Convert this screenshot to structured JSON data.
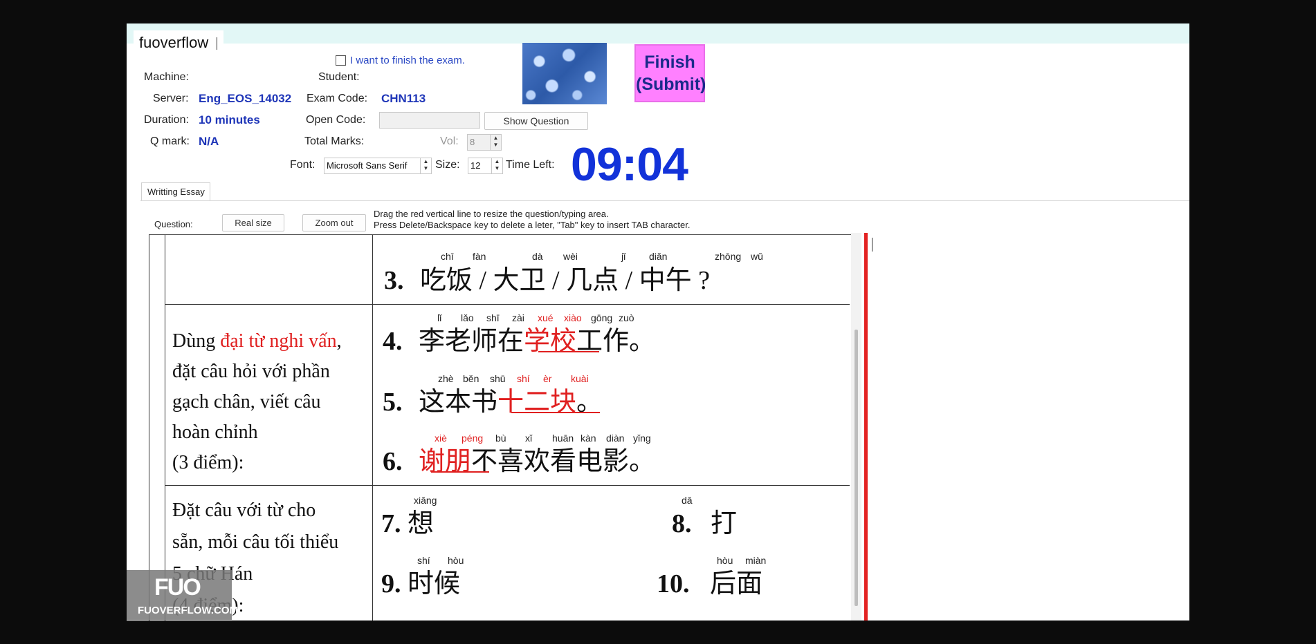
{
  "app": {
    "brand": "fuoverflow",
    "finish_checkbox_label": "I want to finish the exam.",
    "finish_button": [
      "Finish",
      "(Submit)"
    ]
  },
  "info": {
    "machine_label": "Machine:",
    "student_label": "Student:",
    "server_label": "Server:",
    "server_value": "Eng_EOS_14032",
    "exam_code_label": "Exam Code:",
    "exam_code_value": "CHN113",
    "duration_label": "Duration:",
    "duration_value": "10 minutes",
    "open_code_label": "Open Code:",
    "show_question_button": "Show Question",
    "qmark_label": "Q mark:",
    "qmark_value": "N/A",
    "total_marks_label": "Total Marks:",
    "vol_label": "Vol:",
    "vol_value": "8",
    "font_label": "Font:",
    "font_value": "Microsoft Sans Serif",
    "size_label": "Size:",
    "size_value": "12",
    "time_left_label": "Time Left:",
    "time_left_value": "09:04"
  },
  "tabs": [
    "Writting Essay"
  ],
  "question_bar": {
    "question_label": "Question:",
    "real_size_button": "Real size",
    "zoom_out_button": "Zoom out",
    "hint_line1": "Drag the red vertical line to resize the question/typing area.",
    "hint_line2": "Press Delete/Backspace key to delete a leter, \"Tab\" key to insert TAB character."
  },
  "document": {
    "section2": {
      "line1_prefix": "Dùng ",
      "line1_red": "đại từ nghi vấn",
      "line1_suffix": ",",
      "line2": "đặt câu hỏi với phần",
      "line3": "gạch chân, viết câu",
      "line4": "hoàn chỉnh",
      "line5": "(3 điểm):"
    },
    "section3": {
      "line1": "Đặt câu với từ cho",
      "line2": "sẵn, mỗi câu tối thiểu",
      "line3": "5 chữ Hán",
      "line4": "(4 điểm):"
    },
    "q3": {
      "num": "3.",
      "text": "吃饭 / 大卫 / 几点 /  中午 ?",
      "pinyin": [
        "chī",
        "fàn",
        "dà",
        "wèi",
        "jǐ",
        "diǎn",
        "zhōng",
        "wǔ"
      ]
    },
    "q4": {
      "num": "4.",
      "pre": "李老师在",
      "red": "学校",
      "post": "工作。",
      "pinyin": [
        "lǐ",
        "lǎo",
        "shī",
        "zài",
        "xué",
        "xiào",
        "gōng",
        "zuò"
      ]
    },
    "q5": {
      "num": "5.",
      "pre": "这本书",
      "red": "十二块",
      "post": "。",
      "pinyin": [
        "zhè",
        "běn",
        "shū",
        "shí",
        "èr",
        "kuài"
      ]
    },
    "q6": {
      "num": "6.",
      "red": "谢朋",
      "post": "不喜欢看电影。",
      "pinyin": [
        "xiè",
        "péng",
        "bù",
        "xǐ",
        "huān",
        "kàn",
        "diàn",
        "yǐng"
      ]
    },
    "q7": {
      "num": "7.",
      "text": "想",
      "pinyin": [
        "xiǎng"
      ]
    },
    "q8": {
      "num": "8.",
      "text": "打",
      "pinyin": [
        "dǎ"
      ]
    },
    "q9": {
      "num": "9.",
      "text": "时候",
      "pinyin": [
        "shí",
        "hòu"
      ]
    },
    "q10": {
      "num": "10.",
      "text": "后面",
      "pinyin": [
        "hòu",
        "miàn"
      ]
    }
  },
  "watermark": {
    "logo": "FUO",
    "site": "FUOVERFLOW.COM"
  }
}
